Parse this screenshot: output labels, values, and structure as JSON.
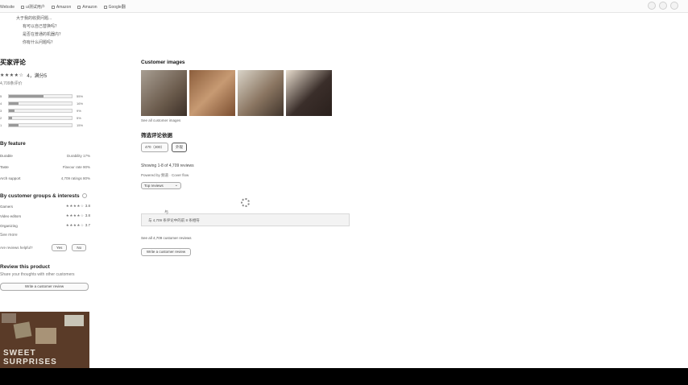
{
  "topbar": {
    "links": [
      {
        "label": "Website"
      },
      {
        "label": "ui测试用户"
      },
      {
        "label": "Amazon"
      },
      {
        "label": "Amazon"
      },
      {
        "label": "Google翻"
      }
    ]
  },
  "faq": [
    "大于我的收费问题...",
    "有可以自己替换吗？",
    "是否在普通的机器内？",
    "你有什么问题吗？"
  ],
  "left": {
    "title": "买家评论",
    "stars": "★★★★☆",
    "rating_text": "4，满分5",
    "ratings_count": "4,709条评价",
    "histogram": [
      {
        "label": "5",
        "pct_label": "55%",
        "pct": 0.55
      },
      {
        "label": "4",
        "pct_label": "16%",
        "pct": 0.16
      },
      {
        "label": "3",
        "pct_label": "9%",
        "pct": 0.09
      },
      {
        "label": "2",
        "pct_label": "5%",
        "pct": 0.05
      },
      {
        "label": "1",
        "pct_label": "15%",
        "pct": 0.15
      }
    ],
    "feature_title": "By feature",
    "features": [
      {
        "name": "Durable",
        "value": "Durability 17%"
      },
      {
        "name": "Taste",
        "value": "Flavour rate 90%"
      },
      {
        "name": "Arch support",
        "value": "4,709 ratings 80%"
      }
    ],
    "groups_title": "By customer groups & interests",
    "groups": [
      {
        "name": "Gamers",
        "stars": "★★★★☆",
        "value": "3.8"
      },
      {
        "name": "Video editors",
        "stars": "★★★★☆",
        "value": "3.8"
      },
      {
        "name": "Organizing",
        "stars": "★★★★☆",
        "value": "3.7"
      }
    ],
    "see_more": "See more",
    "helpful": {
      "label": "Are reviews helpful?",
      "yes": "Yes",
      "no": "No"
    },
    "review_title": "Review this product",
    "review_sub": "Share your thoughts with other customers",
    "write_btn": "Write a customer review",
    "promo_text": "SWEET SURPRISES"
  },
  "main": {
    "ci_title": "Customer images",
    "see_all_images": "See all customer images",
    "filter_title": "筛选评论依据",
    "filters": [
      {
        "label": "470（300）",
        "active": false
      },
      {
        "label": "外观",
        "active": true
      }
    ],
    "showing": "Showing 1-8 of 4,709 reviews",
    "powered": "Powered by 频道 · Cover flow",
    "sort": "Top reviews",
    "reviews_box_tab": "与",
    "reviews_box_text": "与 4,709 条评论中的前 8 条相符",
    "see_all_reviews": "See all 4,709 customer reviews",
    "write_btn": "Write a customer review"
  },
  "colors": {
    "accent": "#999999",
    "bg": "#ffffff",
    "border": "#aaaaaa"
  }
}
